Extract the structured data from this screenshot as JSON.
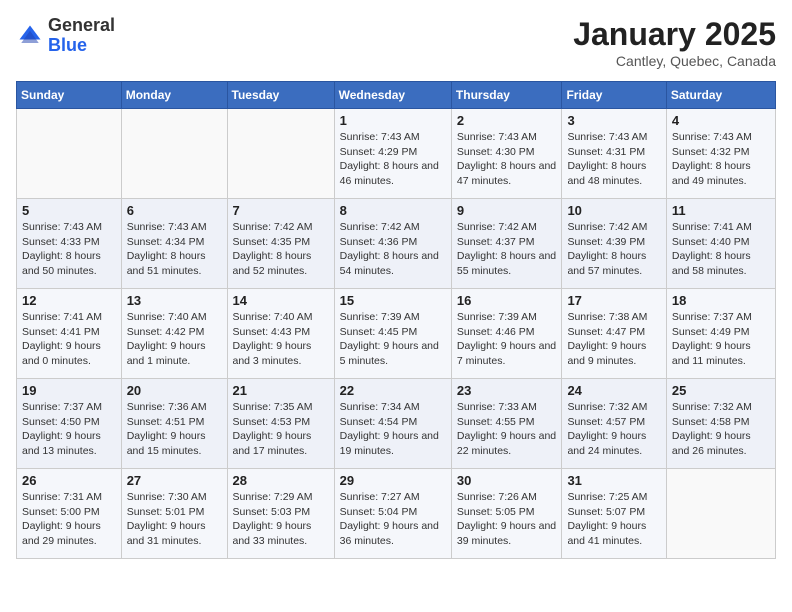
{
  "logo": {
    "general": "General",
    "blue": "Blue"
  },
  "header": {
    "title": "January 2025",
    "subtitle": "Cantley, Quebec, Canada"
  },
  "weekdays": [
    "Sunday",
    "Monday",
    "Tuesday",
    "Wednesday",
    "Thursday",
    "Friday",
    "Saturday"
  ],
  "weeks": [
    [
      {
        "day": "",
        "sunrise": "",
        "sunset": "",
        "daylight": ""
      },
      {
        "day": "",
        "sunrise": "",
        "sunset": "",
        "daylight": ""
      },
      {
        "day": "",
        "sunrise": "",
        "sunset": "",
        "daylight": ""
      },
      {
        "day": "1",
        "sunrise": "Sunrise: 7:43 AM",
        "sunset": "Sunset: 4:29 PM",
        "daylight": "Daylight: 8 hours and 46 minutes."
      },
      {
        "day": "2",
        "sunrise": "Sunrise: 7:43 AM",
        "sunset": "Sunset: 4:30 PM",
        "daylight": "Daylight: 8 hours and 47 minutes."
      },
      {
        "day": "3",
        "sunrise": "Sunrise: 7:43 AM",
        "sunset": "Sunset: 4:31 PM",
        "daylight": "Daylight: 8 hours and 48 minutes."
      },
      {
        "day": "4",
        "sunrise": "Sunrise: 7:43 AM",
        "sunset": "Sunset: 4:32 PM",
        "daylight": "Daylight: 8 hours and 49 minutes."
      }
    ],
    [
      {
        "day": "5",
        "sunrise": "Sunrise: 7:43 AM",
        "sunset": "Sunset: 4:33 PM",
        "daylight": "Daylight: 8 hours and 50 minutes."
      },
      {
        "day": "6",
        "sunrise": "Sunrise: 7:43 AM",
        "sunset": "Sunset: 4:34 PM",
        "daylight": "Daylight: 8 hours and 51 minutes."
      },
      {
        "day": "7",
        "sunrise": "Sunrise: 7:42 AM",
        "sunset": "Sunset: 4:35 PM",
        "daylight": "Daylight: 8 hours and 52 minutes."
      },
      {
        "day": "8",
        "sunrise": "Sunrise: 7:42 AM",
        "sunset": "Sunset: 4:36 PM",
        "daylight": "Daylight: 8 hours and 54 minutes."
      },
      {
        "day": "9",
        "sunrise": "Sunrise: 7:42 AM",
        "sunset": "Sunset: 4:37 PM",
        "daylight": "Daylight: 8 hours and 55 minutes."
      },
      {
        "day": "10",
        "sunrise": "Sunrise: 7:42 AM",
        "sunset": "Sunset: 4:39 PM",
        "daylight": "Daylight: 8 hours and 57 minutes."
      },
      {
        "day": "11",
        "sunrise": "Sunrise: 7:41 AM",
        "sunset": "Sunset: 4:40 PM",
        "daylight": "Daylight: 8 hours and 58 minutes."
      }
    ],
    [
      {
        "day": "12",
        "sunrise": "Sunrise: 7:41 AM",
        "sunset": "Sunset: 4:41 PM",
        "daylight": "Daylight: 9 hours and 0 minutes."
      },
      {
        "day": "13",
        "sunrise": "Sunrise: 7:40 AM",
        "sunset": "Sunset: 4:42 PM",
        "daylight": "Daylight: 9 hours and 1 minute."
      },
      {
        "day": "14",
        "sunrise": "Sunrise: 7:40 AM",
        "sunset": "Sunset: 4:43 PM",
        "daylight": "Daylight: 9 hours and 3 minutes."
      },
      {
        "day": "15",
        "sunrise": "Sunrise: 7:39 AM",
        "sunset": "Sunset: 4:45 PM",
        "daylight": "Daylight: 9 hours and 5 minutes."
      },
      {
        "day": "16",
        "sunrise": "Sunrise: 7:39 AM",
        "sunset": "Sunset: 4:46 PM",
        "daylight": "Daylight: 9 hours and 7 minutes."
      },
      {
        "day": "17",
        "sunrise": "Sunrise: 7:38 AM",
        "sunset": "Sunset: 4:47 PM",
        "daylight": "Daylight: 9 hours and 9 minutes."
      },
      {
        "day": "18",
        "sunrise": "Sunrise: 7:37 AM",
        "sunset": "Sunset: 4:49 PM",
        "daylight": "Daylight: 9 hours and 11 minutes."
      }
    ],
    [
      {
        "day": "19",
        "sunrise": "Sunrise: 7:37 AM",
        "sunset": "Sunset: 4:50 PM",
        "daylight": "Daylight: 9 hours and 13 minutes."
      },
      {
        "day": "20",
        "sunrise": "Sunrise: 7:36 AM",
        "sunset": "Sunset: 4:51 PM",
        "daylight": "Daylight: 9 hours and 15 minutes."
      },
      {
        "day": "21",
        "sunrise": "Sunrise: 7:35 AM",
        "sunset": "Sunset: 4:53 PM",
        "daylight": "Daylight: 9 hours and 17 minutes."
      },
      {
        "day": "22",
        "sunrise": "Sunrise: 7:34 AM",
        "sunset": "Sunset: 4:54 PM",
        "daylight": "Daylight: 9 hours and 19 minutes."
      },
      {
        "day": "23",
        "sunrise": "Sunrise: 7:33 AM",
        "sunset": "Sunset: 4:55 PM",
        "daylight": "Daylight: 9 hours and 22 minutes."
      },
      {
        "day": "24",
        "sunrise": "Sunrise: 7:32 AM",
        "sunset": "Sunset: 4:57 PM",
        "daylight": "Daylight: 9 hours and 24 minutes."
      },
      {
        "day": "25",
        "sunrise": "Sunrise: 7:32 AM",
        "sunset": "Sunset: 4:58 PM",
        "daylight": "Daylight: 9 hours and 26 minutes."
      }
    ],
    [
      {
        "day": "26",
        "sunrise": "Sunrise: 7:31 AM",
        "sunset": "Sunset: 5:00 PM",
        "daylight": "Daylight: 9 hours and 29 minutes."
      },
      {
        "day": "27",
        "sunrise": "Sunrise: 7:30 AM",
        "sunset": "Sunset: 5:01 PM",
        "daylight": "Daylight: 9 hours and 31 minutes."
      },
      {
        "day": "28",
        "sunrise": "Sunrise: 7:29 AM",
        "sunset": "Sunset: 5:03 PM",
        "daylight": "Daylight: 9 hours and 33 minutes."
      },
      {
        "day": "29",
        "sunrise": "Sunrise: 7:27 AM",
        "sunset": "Sunset: 5:04 PM",
        "daylight": "Daylight: 9 hours and 36 minutes."
      },
      {
        "day": "30",
        "sunrise": "Sunrise: 7:26 AM",
        "sunset": "Sunset: 5:05 PM",
        "daylight": "Daylight: 9 hours and 39 minutes."
      },
      {
        "day": "31",
        "sunrise": "Sunrise: 7:25 AM",
        "sunset": "Sunset: 5:07 PM",
        "daylight": "Daylight: 9 hours and 41 minutes."
      },
      {
        "day": "",
        "sunrise": "",
        "sunset": "",
        "daylight": ""
      }
    ]
  ]
}
